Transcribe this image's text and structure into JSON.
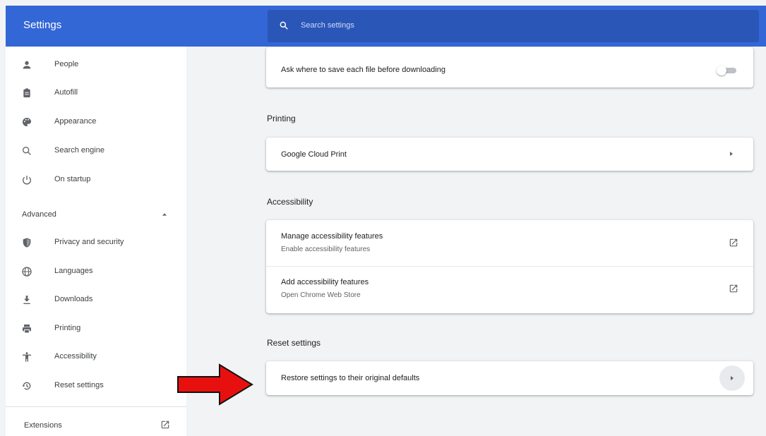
{
  "header": {
    "title": "Settings",
    "search_placeholder": "Search settings"
  },
  "sidebar": {
    "items": [
      {
        "label": "People",
        "icon": "person-icon"
      },
      {
        "label": "Autofill",
        "icon": "clipboard-icon"
      },
      {
        "label": "Appearance",
        "icon": "palette-icon"
      },
      {
        "label": "Search engine",
        "icon": "search-icon"
      },
      {
        "label": "On startup",
        "icon": "power-icon"
      }
    ],
    "advanced_label": "Advanced",
    "advanced_items": [
      {
        "label": "Privacy and security",
        "icon": "shield-icon"
      },
      {
        "label": "Languages",
        "icon": "globe-icon"
      },
      {
        "label": "Downloads",
        "icon": "download-icon"
      },
      {
        "label": "Printing",
        "icon": "printer-icon"
      },
      {
        "label": "Accessibility",
        "icon": "accessibility-icon"
      },
      {
        "label": "Reset settings",
        "icon": "history-icon"
      }
    ],
    "extensions_label": "Extensions"
  },
  "main": {
    "downloads_row": {
      "label": "Ask where to save each file before downloading",
      "enabled": false
    },
    "printing": {
      "title": "Printing",
      "row_label": "Google Cloud Print"
    },
    "accessibility": {
      "title": "Accessibility",
      "rows": [
        {
          "title": "Manage accessibility features",
          "subtitle": "Enable accessibility features"
        },
        {
          "title": "Add accessibility features",
          "subtitle": "Open Chrome Web Store"
        }
      ]
    },
    "reset": {
      "title": "Reset settings",
      "row_label": "Restore settings to their original defaults"
    }
  },
  "colors": {
    "header_blue": "#3367d6",
    "search_blue": "#2a56b8",
    "annotation_red": "#e8100f"
  }
}
